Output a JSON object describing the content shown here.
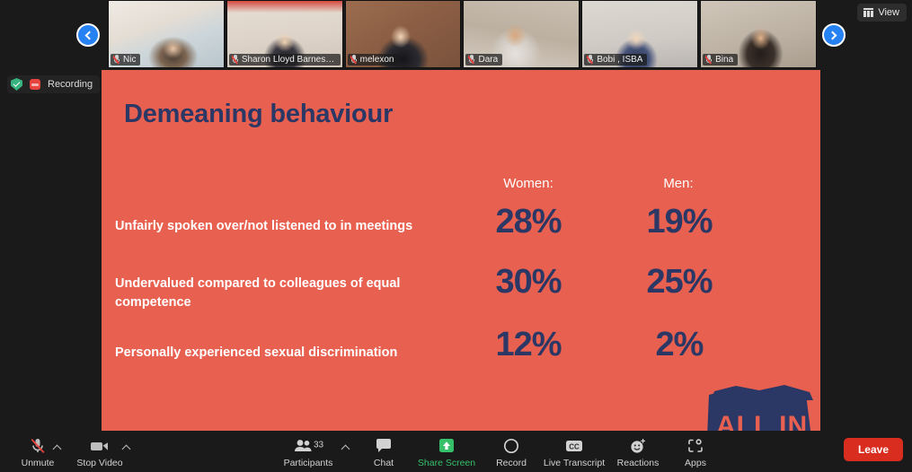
{
  "app": "Zoom Meeting",
  "top_bar": {
    "view_button": {
      "label": "View",
      "icon": "grid-icon"
    },
    "nav_prev_icon": "chevron-left-icon",
    "nav_next_icon": "chevron-right-icon"
  },
  "status": {
    "encryption_icon": "shield-check-icon",
    "recording_icon": "recording-icon",
    "recording_label": "Recording"
  },
  "participants_strip": [
    {
      "name": "Nic",
      "muted": true,
      "tile_bg": "#cfc6bb"
    },
    {
      "name": "Sharon Lloyd Barnes, ...",
      "muted": true,
      "tile_bg": "#d9cec4"
    },
    {
      "name": "melexon",
      "muted": true,
      "tile_bg": "#9a6c51"
    },
    {
      "name": "Dara",
      "muted": true,
      "tile_bg": "#b6a99c"
    },
    {
      "name": "Bobi , ISBA",
      "muted": true,
      "tile_bg": "#cdc7c1"
    },
    {
      "name": "Bina",
      "muted": true,
      "tile_bg": "#bfb3a6"
    }
  ],
  "slide": {
    "title": "Demeaning behaviour",
    "background_color": "#e8604f",
    "accent_color": "#2b3765",
    "logo_text": "ALL IN",
    "columns": [
      "Women:",
      "Men:"
    ],
    "rows": [
      {
        "label": "Unfairly spoken over/not listened to in meetings",
        "women": "28%",
        "men": "19%"
      },
      {
        "label": "Undervalued compared to colleagues of equal competence",
        "women": "30%",
        "men": "25%"
      },
      {
        "label": "Personally experienced sexual discrimination",
        "women": "12%",
        "men": "2%"
      }
    ]
  },
  "chart_data": {
    "type": "table",
    "title": "Demeaning behaviour",
    "categories": [
      "Unfairly spoken over/not listened to in meetings",
      "Undervalued compared to colleagues of equal competence",
      "Personally experienced sexual discrimination"
    ],
    "series": [
      {
        "name": "Women:",
        "values": [
          28,
          30,
          12
        ]
      },
      {
        "name": "Men:",
        "values": [
          19,
          25,
          2
        ]
      }
    ],
    "unit": "%",
    "ylabel": "",
    "xlabel": "",
    "legend": "column-headers"
  },
  "toolbar": {
    "mute": {
      "label": "Unmute",
      "icon": "microphone-muted-icon",
      "has_caret": true
    },
    "video": {
      "label": "Stop Video",
      "icon": "video-camera-icon",
      "has_caret": true
    },
    "participants": {
      "label": "Participants",
      "icon": "participants-icon",
      "count": "33",
      "has_caret": true
    },
    "chat": {
      "label": "Chat",
      "icon": "chat-bubble-icon"
    },
    "share": {
      "label": "Share Screen",
      "icon": "share-screen-icon",
      "color": "#36c06a"
    },
    "record": {
      "label": "Record",
      "icon": "record-circle-icon"
    },
    "transcript": {
      "label": "Live Transcript",
      "icon": "closed-caption-icon"
    },
    "reactions": {
      "label": "Reactions",
      "icon": "reactions-smiley-icon"
    },
    "apps": {
      "label": "Apps",
      "icon": "apps-icon"
    },
    "leave": {
      "label": "Leave"
    }
  }
}
